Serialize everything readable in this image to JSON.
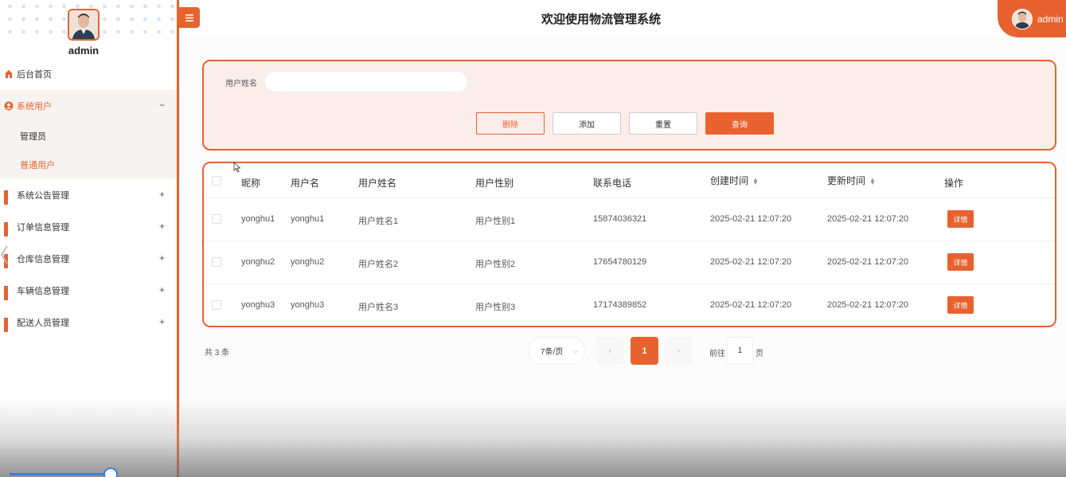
{
  "header": {
    "title": "欢迎使用物流管理系统",
    "user": "admin"
  },
  "sidebar": {
    "admin_name": "admin",
    "items": [
      {
        "label": "后台首页",
        "icon": "home-icon"
      },
      {
        "label": "系统用户",
        "icon": "user-circle-icon",
        "expanded": true,
        "toggle": "−",
        "children": [
          {
            "label": "管理员"
          },
          {
            "label": "普通用户",
            "active": true
          }
        ]
      },
      {
        "label": "系统公告管理",
        "icon": "grid-icon",
        "toggle": "+"
      },
      {
        "label": "订单信息管理",
        "icon": "grid-icon",
        "toggle": "+"
      },
      {
        "label": "仓库信息管理",
        "icon": "grid-icon",
        "toggle": "+"
      },
      {
        "label": "车辆信息管理",
        "icon": "grid-icon",
        "toggle": "+"
      },
      {
        "label": "配送人员管理",
        "icon": "grid-icon",
        "toggle": "+"
      }
    ]
  },
  "search": {
    "label": "用户姓名",
    "value": "",
    "buttons": {
      "delete": "删除",
      "add": "添加",
      "reset": "重置",
      "query": "查询"
    }
  },
  "table": {
    "columns": [
      "昵称",
      "用户名",
      "用户姓名",
      "用户性别",
      "联系电话",
      "创建时间",
      "更新时间",
      "操作"
    ],
    "rows": [
      {
        "nickname": "yonghu1",
        "username": "yonghu1",
        "realname": "用户姓名1",
        "gender": "用户性别1",
        "phone": "15874036321",
        "created": "2025-02-21 12:07:20",
        "updated": "2025-02-21 12:07:20",
        "action": "详情"
      },
      {
        "nickname": "yonghu2",
        "username": "yonghu2",
        "realname": "用户姓名2",
        "gender": "用户性别2",
        "phone": "17654780129",
        "created": "2025-02-21 12:07:20",
        "updated": "2025-02-21 12:07:20",
        "action": "详情"
      },
      {
        "nickname": "yonghu3",
        "username": "yonghu3",
        "realname": "用户姓名3",
        "gender": "用户性别3",
        "phone": "17174389852",
        "created": "2025-02-21 12:07:20",
        "updated": "2025-02-21 12:07:20",
        "action": "详情"
      }
    ]
  },
  "pagination": {
    "total": "共 3 条",
    "page_size": "7条/页",
    "prev": "‹",
    "current": "1",
    "next": "›",
    "goto_label": "前往",
    "goto_value": "1",
    "page_suffix": "页"
  },
  "colors": {
    "accent": "#e8622f",
    "panel_bg": "#fbeeea"
  }
}
